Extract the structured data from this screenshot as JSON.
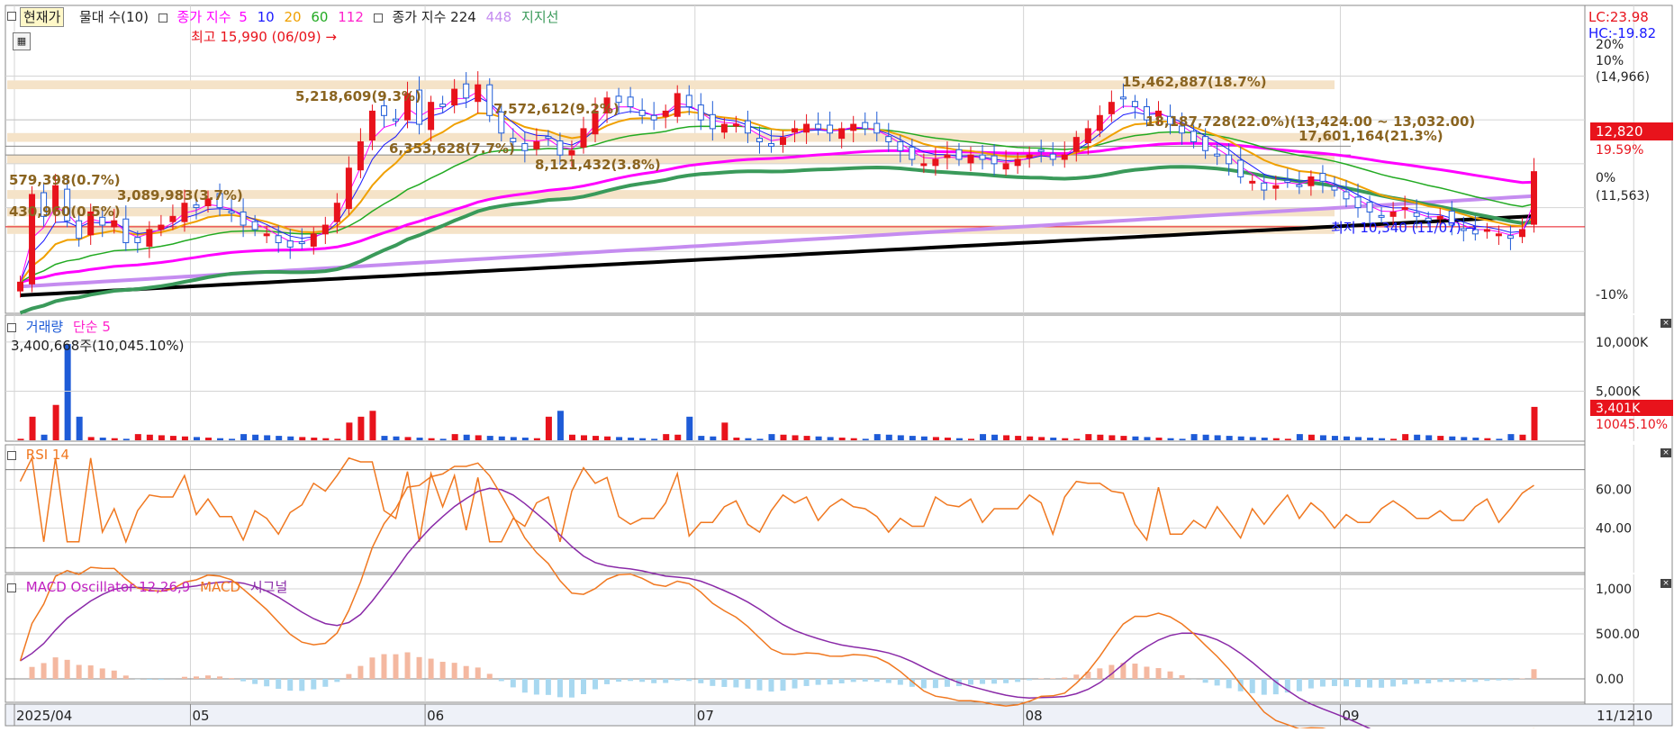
{
  "legend": {
    "current_price": "현재가",
    "volume_band": "물대 수(10)",
    "ma_prefix": "종가 지수",
    "ma_periods": [
      "5",
      "10",
      "20",
      "60",
      "112"
    ],
    "ma_colors": [
      "#ff00ff",
      "#1a1aff",
      "#f0a000",
      "#22aa22",
      "#ff22cc"
    ],
    "long_ma_label": "종가 지수 224",
    "long_ma_extra": "448",
    "support_label": "지지선"
  },
  "right_labels": {
    "lc": "LC:23.98",
    "hc": "HC:-19.82",
    "pct20": "20%",
    "pct10": "10%",
    "price_top": "(14,966)",
    "current_price": "12,820",
    "current_pct": "19.59%",
    "pct0": "0%",
    "price_base": "(11,563)",
    "pctm10": "-10%"
  },
  "annotations": {
    "high": "최고 15,990 (06/09)",
    "low": "최저 10,340 (11/07)",
    "vp_labels": [
      "5,218,609(9.3%)",
      "7,572,612(9.2%)",
      "6,353,628(7.7%)",
      "8,121,432(3.8%)",
      "579,398(0.7%)",
      "3,089,983(3.7%)",
      "430,960(0.5%)",
      "15,462,887(18.7%)",
      "18,187,728(22.0%)(13,424.00 ~ 13,032.00)",
      "17,601,164(21.3%)"
    ]
  },
  "volume_panel": {
    "title": "거래량",
    "ma_label": "단순 5",
    "value_text": "3,400,668주(10,045.10%)",
    "axis": [
      "10,000K",
      "5,000K"
    ],
    "current": "3,401K",
    "current_pct": "10045.10%"
  },
  "rsi_panel": {
    "title": "RSI 14",
    "axis": [
      "60.00",
      "40.00"
    ]
  },
  "macd_panel": {
    "title": "MACD Oscillator 12,26,9",
    "macd_label": "MACD",
    "signal_label": "시그널",
    "axis": [
      "1,000",
      "500.00",
      "0.00"
    ]
  },
  "x_axis": {
    "labels": [
      "2025/04",
      "05",
      "06",
      "07",
      "08",
      "09",
      "10",
      "11"
    ],
    "end_label": "11/12"
  },
  "colors": {
    "up": "#e8131c",
    "down": "#1e5bd7",
    "grid": "#d4d4d4",
    "panel_border": "#8a8a8a",
    "vp_band": "#f5e3c8",
    "ma224": "#000000",
    "ma448": "#c58cf0",
    "support": "#3a9a5a",
    "rsi": "#f07820",
    "macd": "#f07820",
    "signal": "#8a2aa8",
    "osc_pos": "#f4b8a0",
    "osc_neg": "#a8d8f0"
  },
  "chart_data": {
    "type": "candlestick",
    "title": "",
    "date_range": [
      "2025/04",
      "11/12"
    ],
    "x_ticks": [
      "2025/04",
      "05",
      "06",
      "07",
      "08",
      "09",
      "10",
      "11"
    ],
    "price_range": [
      10000,
      16200
    ],
    "high": {
      "value": 15990,
      "date": "06/09"
    },
    "low": {
      "value": 10340,
      "date": "11/07"
    },
    "last_close": 12820,
    "base_price": 11563,
    "close_series": [
      10300,
      12300,
      11800,
      12500,
      11700,
      11300,
      11900,
      11600,
      11700,
      11200,
      11200,
      11500,
      11600,
      11800,
      12100,
      12000,
      12200,
      12000,
      11900,
      11600,
      11500,
      11400,
      11200,
      11100,
      11200,
      11400,
      11600,
      12100,
      12900,
      13500,
      14200,
      14100,
      14000,
      14600,
      13900,
      14400,
      14300,
      14700,
      14500,
      14800,
      14100,
      13700,
      13500,
      13300,
      13500,
      13600,
      13200,
      13300,
      13800,
      14200,
      14500,
      14400,
      14300,
      14100,
      14000,
      14200,
      14600,
      14300,
      14000,
      13800,
      13900,
      13900,
      13700,
      13500,
      13400,
      13600,
      13800,
      13900,
      13800,
      13700,
      13800,
      13900,
      13800,
      13700,
      13500,
      13300,
      13100,
      13000,
      13100,
      13200,
      13100,
      13200,
      13100,
      13000,
      13000,
      13100,
      13200,
      13300,
      13100,
      13200,
      13600,
      13800,
      14100,
      14400,
      14500,
      14300,
      14000,
      14200,
      13900,
      13700,
      13500,
      13300,
      13200,
      13000,
      12700,
      12600,
      12400,
      12500,
      12600,
      12500,
      12700,
      12600,
      12400,
      12200,
      12000,
      11900,
      11800,
      11900,
      12000,
      11800,
      11700,
      11800,
      11600,
      11500,
      11400,
      11500,
      11400,
      11300,
      11500,
      12820
    ],
    "volume_K": {
      "max_axis": 10000,
      "spike_start": 9800,
      "last": 3401
    },
    "rsi_range": [
      20,
      80
    ],
    "rsi_last": 62,
    "macd_range": [
      -200,
      1100
    ]
  }
}
